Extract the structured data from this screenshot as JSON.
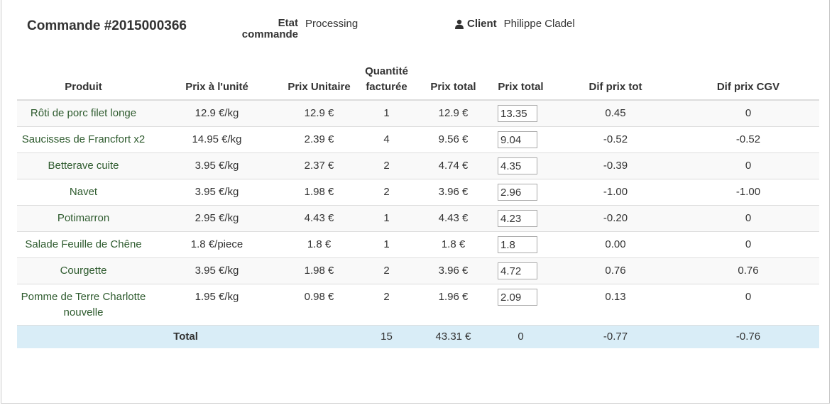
{
  "order": {
    "title": "Commande #2015000366",
    "state_label": "Etat commande",
    "state_value": "Processing",
    "client_icon": "user-icon",
    "client_label": "Client",
    "client_value": "Philippe Cladel"
  },
  "table": {
    "headers": [
      "Produit",
      "Prix à l'unité",
      "Prix Unitaire",
      "Quantité facturée",
      "Prix total",
      "Prix total",
      "Dif prix tot",
      "Dif prix CGV"
    ],
    "rows": [
      {
        "product": "Rôti de porc filet longe",
        "unit_price": "12.9 €/kg",
        "prix_unitaire": "12.9 €",
        "qty": "1",
        "total": "12.9 €",
        "input": "13.35",
        "dif_tot": "0.45",
        "dif_cgv": "0"
      },
      {
        "product": "Saucisses de Francfort x2",
        "unit_price": "14.95 €/kg",
        "prix_unitaire": "2.39 €",
        "qty": "4",
        "total": "9.56 €",
        "input": "9.04",
        "dif_tot": "-0.52",
        "dif_cgv": "-0.52"
      },
      {
        "product": "Betterave cuite",
        "unit_price": "3.95 €/kg",
        "prix_unitaire": "2.37 €",
        "qty": "2",
        "total": "4.74 €",
        "input": "4.35",
        "dif_tot": "-0.39",
        "dif_cgv": "0"
      },
      {
        "product": "Navet",
        "unit_price": "3.95 €/kg",
        "prix_unitaire": "1.98 €",
        "qty": "2",
        "total": "3.96 €",
        "input": "2.96",
        "dif_tot": "-1.00",
        "dif_cgv": "-1.00"
      },
      {
        "product": "Potimarron",
        "unit_price": "2.95 €/kg",
        "prix_unitaire": "4.43 €",
        "qty": "1",
        "total": "4.43 €",
        "input": "4.23",
        "dif_tot": "-0.20",
        "dif_cgv": "0"
      },
      {
        "product": "Salade Feuille de Chêne",
        "unit_price": "1.8 €/piece",
        "prix_unitaire": "1.8 €",
        "qty": "1",
        "total": "1.8 €",
        "input": "1.8",
        "dif_tot": "0.00",
        "dif_cgv": "0"
      },
      {
        "product": "Courgette",
        "unit_price": "3.95 €/kg",
        "prix_unitaire": "1.98 €",
        "qty": "2",
        "total": "3.96 €",
        "input": "4.72",
        "dif_tot": "0.76",
        "dif_cgv": "0.76"
      },
      {
        "product": "Pomme de Terre Charlotte nouvelle",
        "unit_price": "1.95 €/kg",
        "prix_unitaire": "0.98 €",
        "qty": "2",
        "total": "1.96 €",
        "input": "2.09",
        "dif_tot": "0.13",
        "dif_cgv": "0"
      }
    ],
    "footer": {
      "label": "Total",
      "qty": "15",
      "total": "43.31 €",
      "input_total": "0",
      "dif_tot": "-0.77",
      "dif_cgv": "-0.76"
    }
  },
  "colors": {
    "product_text": "#2e5b2e",
    "footer_bg": "#d9edf7",
    "stripe_bg": "#f9f9f9"
  }
}
